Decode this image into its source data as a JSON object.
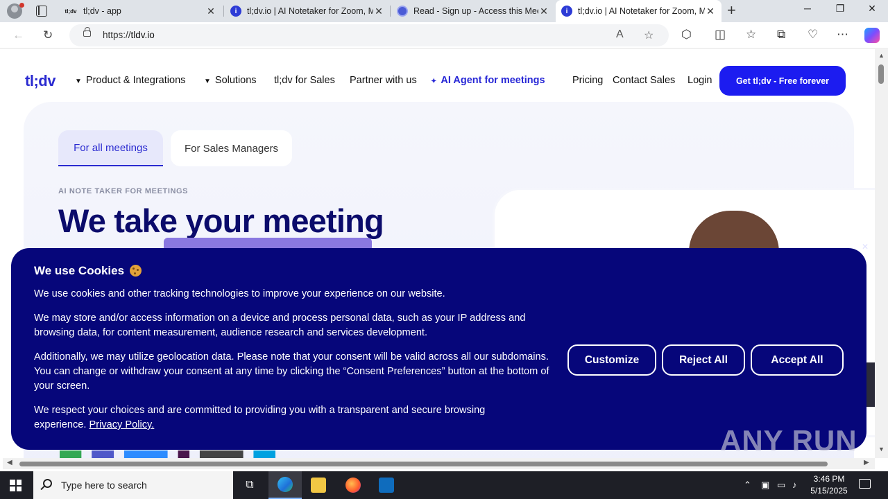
{
  "browser": {
    "tabs": [
      {
        "title": "tl;dv - app",
        "favicon": "tldv",
        "active": false
      },
      {
        "title": "tl;dv.io | AI Notetaker for Zoom, M",
        "favicon": "info",
        "active": false
      },
      {
        "title": "Read - Sign up - Access this Meet",
        "favicon": "read",
        "active": false
      },
      {
        "title": "tl;dv.io | AI Notetaker for Zoom, M",
        "favicon": "info",
        "active": true
      }
    ],
    "url_prefix": "https://",
    "url_host": "tldv.io",
    "tab_close_glyph": "✕",
    "new_tab_glyph": "+",
    "window": {
      "minimize": "─",
      "restore": "❐",
      "close": "✕"
    }
  },
  "site": {
    "logo": "tl;dv",
    "nav": {
      "product": "Product & Integrations",
      "solutions": "Solutions",
      "sales": "tl;dv for Sales",
      "partner": "Partner with us",
      "agent": "AI Agent for meetings",
      "pricing": "Pricing",
      "contact": "Contact Sales",
      "login": "Login"
    },
    "cta": "Get tl;dv - Free forever",
    "segments": {
      "active": "For all meetings",
      "inactive": "For Sales Managers"
    },
    "eyebrow": "AI NOTE TAKER FOR MEETINGS",
    "headline": "We take your meeting"
  },
  "cookie_banner": {
    "title": "We use Cookies",
    "paragraphs": [
      "We use cookies and other tracking technologies to improve your experience on our website.",
      "We may store and/or access information on a device and process personal data, such as your IP address and browsing data, for content measurement, audience research and services development.",
      "Additionally, we may utilize geolocation data. Please note that your consent will be valid across all our subdomains. You can change or withdraw your consent at any time by clicking the “Consent Preferences” button at the bottom of your screen.",
      "We respect your choices and are committed to providing you with a transparent and secure browsing experience."
    ],
    "privacy_link": "Privacy Policy.",
    "buttons": {
      "customize": "Customize",
      "reject": "Reject All",
      "accept": "Accept All"
    },
    "close_glyph": "✕"
  },
  "watermark": "ANY RUN",
  "taskbar": {
    "search_placeholder": "Type here to search",
    "time": "3:46 PM",
    "date": "5/15/2025"
  },
  "colors": {
    "brand": "#2a2ad0",
    "cta": "#1c1cf0",
    "banner": "#06067a",
    "headline": "#0b0b6b"
  }
}
